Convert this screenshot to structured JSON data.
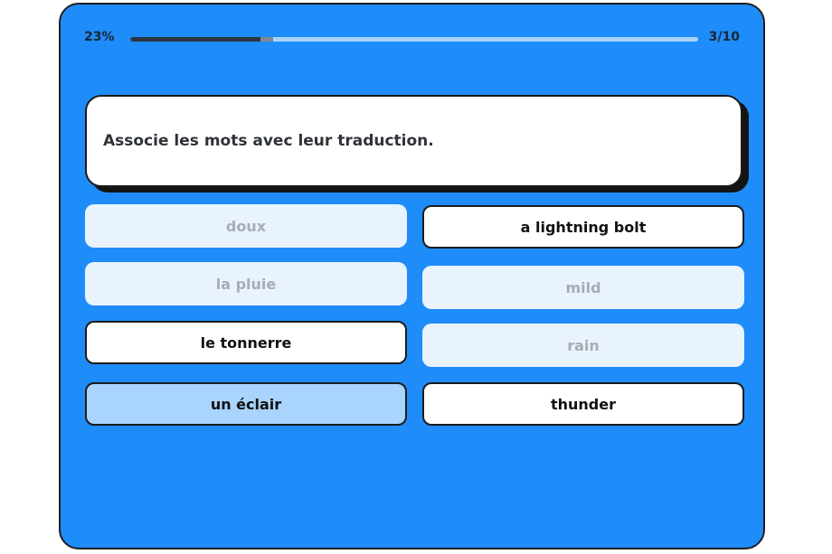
{
  "progress": {
    "percent_label": "23%",
    "fraction": 0.23,
    "count_label": "3/10"
  },
  "question": {
    "text": "Associe les mots avec leur traduction."
  },
  "left_words": [
    {
      "label": "doux",
      "state": "matched"
    },
    {
      "label": "la pluie",
      "state": "matched"
    },
    {
      "label": "le tonnerre",
      "state": "available"
    },
    {
      "label": "un éclair",
      "state": "selected"
    }
  ],
  "right_words": [
    {
      "label": "a lightning bolt",
      "state": "available"
    },
    {
      "label": "mild",
      "state": "matched"
    },
    {
      "label": "rain",
      "state": "matched"
    },
    {
      "label": "thunder",
      "state": "available"
    }
  ],
  "colors": {
    "card_background": "#1e8cf9",
    "matched_tile": "#e9f3fe",
    "selected_tile": "#a9d4fd",
    "progress_fill": "#2b3640"
  }
}
